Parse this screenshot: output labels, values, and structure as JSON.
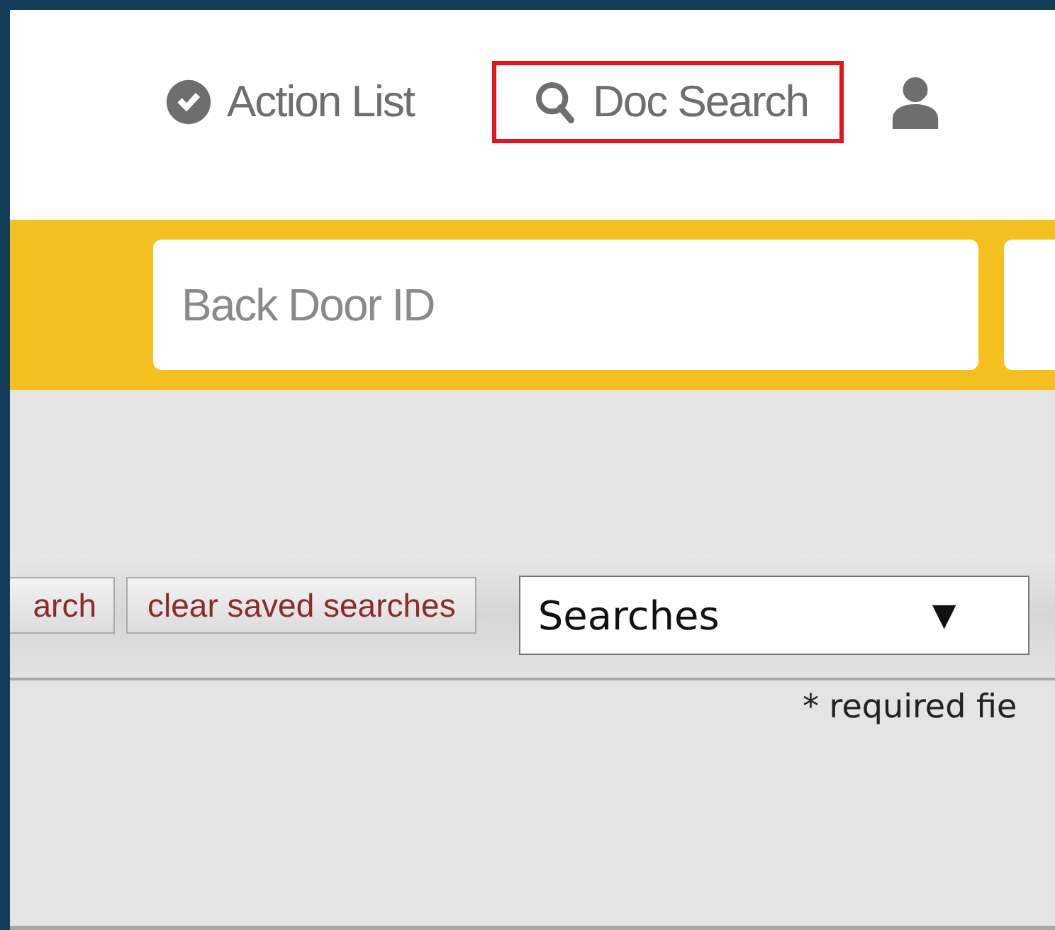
{
  "nav": [
    {
      "label": "Action List",
      "kind": "check",
      "selected": false
    },
    {
      "label": "Doc Search",
      "kind": "search",
      "selected": true
    },
    {
      "kind": "user",
      "selected": false
    }
  ],
  "search_bar": {
    "placeholder": "Back Door ID"
  },
  "toolbar": {
    "buttons": [
      "arch",
      "clear saved searches"
    ],
    "select": {
      "value": "Searches",
      "caret": "▼"
    }
  },
  "note": "* required fie"
}
